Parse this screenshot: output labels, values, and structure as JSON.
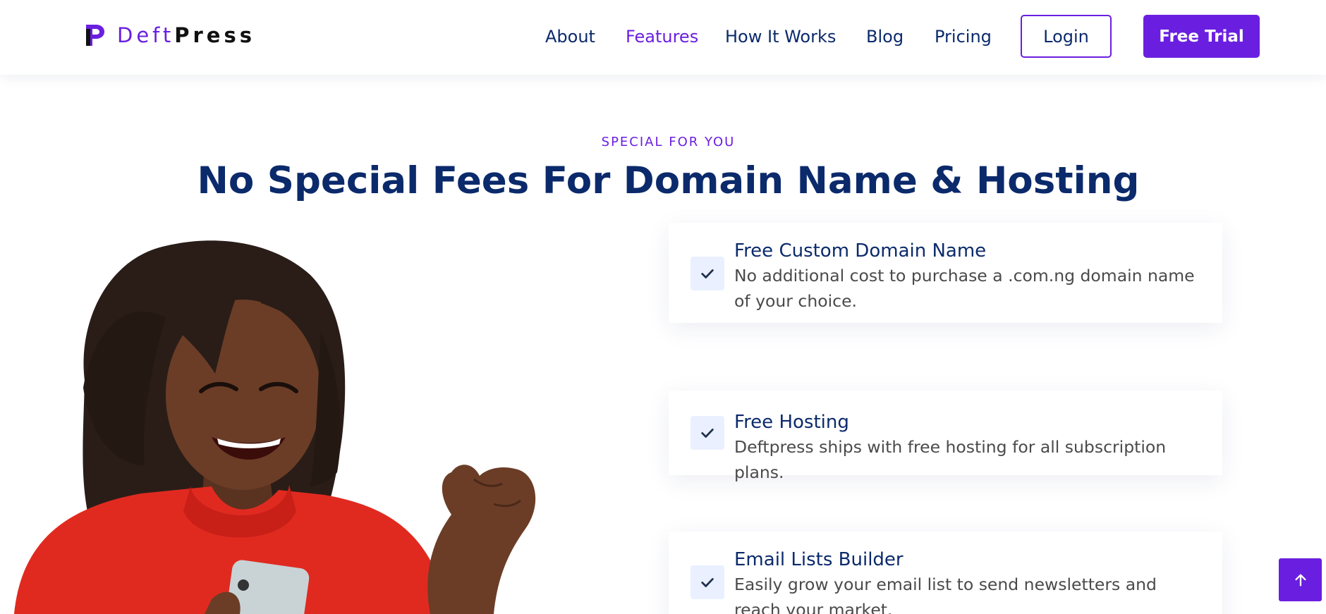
{
  "brand": {
    "name_part1": "Deft",
    "name_part2": "Press",
    "logo_icon": "deftpress-logo-icon"
  },
  "nav": {
    "links": [
      {
        "label": "About",
        "active": false
      },
      {
        "label": "Features",
        "active": true
      },
      {
        "label": "How It Works",
        "active": false
      },
      {
        "label": "Blog",
        "active": false
      },
      {
        "label": "Pricing",
        "active": false
      }
    ],
    "login_label": "Login",
    "trial_label": "Free Trial"
  },
  "section": {
    "eyebrow": "SPECIAL FOR YOU",
    "title": "No Special Fees For Domain Name & Hosting"
  },
  "features": [
    {
      "title": "Free Custom Domain Name",
      "description": "No additional cost to purchase a .com.ng domain name of your choice.",
      "icon": "check-icon"
    },
    {
      "title": "Free Hosting",
      "description": "Deftpress ships with free hosting for all subscription plans.",
      "icon": "check-icon"
    },
    {
      "title": "Email Lists Builder",
      "description": "Easily grow your email list to send newsletters and reach your market.",
      "icon": "check-icon"
    }
  ],
  "scroll_top_icon": "arrow-up-icon",
  "colors": {
    "accent": "#6a1fe0",
    "navy": "#0b2a6b",
    "text_gray": "#4a4a4a",
    "check_bg": "#eaf0ff"
  }
}
